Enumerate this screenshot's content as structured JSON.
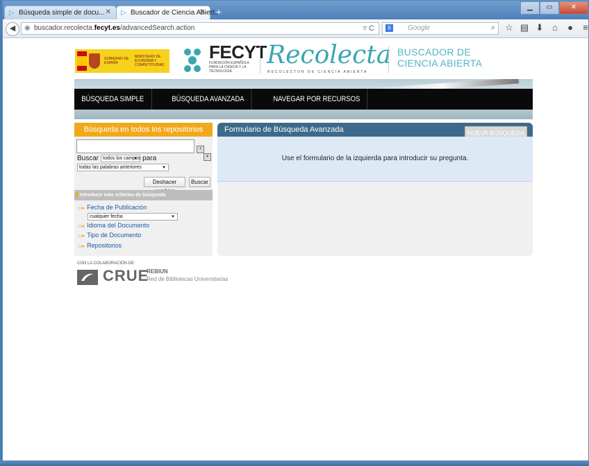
{
  "browser": {
    "tabs": [
      {
        "label": "Búsqueda simple de docu...",
        "active": false
      },
      {
        "label": "Buscador de Ciencia Abiert...",
        "active": true
      }
    ],
    "new_tab": "+",
    "url_prefix": "buscador.recolecta.",
    "url_host": "fecyt.es",
    "url_path": "/advancedSearch.action",
    "search_placeholder": "Google",
    "search_engine_icon": "8",
    "window_controls": [
      "minimize",
      "maximize",
      "close"
    ]
  },
  "header": {
    "gob_1": "GOBIERNO DE ESPAÑA",
    "gob_2": "MINISTERIO DE ECONOMÍA Y COMPETITIVIDAD",
    "fecyt": "FECYT",
    "fecyt_sub": "FUNDACIÓN ESPAÑOLA PARA LA CIENCIA Y LA TECNOLOGÍA",
    "recolecta": "Recolecta",
    "recolecta_sub": "RECOLECTOR DE CIENCIA ABIERTA",
    "buscador_1": "BUSCADOR DE",
    "buscador_2": "CIENCIA ABIERTA"
  },
  "menu": [
    "BÚSQUEDA SIMPLE",
    "BÚSQUEDA AVANZADA",
    "NAVEGAR POR RECURSOS"
  ],
  "left": {
    "title": "Búsqueda en todos los repositorios",
    "buscar": "Buscar",
    "campos": "todos los campos",
    "para": "para",
    "palabras": "todas las palabras anteriores",
    "deshacer": "Deshacer cambios",
    "buscar_btn": "Buscar",
    "criteria_title": "Introducir más criterios de búsqueda",
    "fecha": "Fecha de Publicación",
    "fecha_val": "cualquier fecha",
    "idioma": "Idioma del Documento",
    "tipo": "Tipo de Documento",
    "repos": "Repositorios"
  },
  "right": {
    "title": "Formulario de Búsqueda Avanzada",
    "new_search": "NUEVA BÚSQUEDA",
    "message": "Use el formulario de la izquierda para introducir su pregunta."
  },
  "footer": {
    "collab": "CON LA COLABORACIÓN DE:",
    "crue": "CRUE",
    "rebiun": "REBIUN",
    "rebiun_sub": "Red de Bibliotecas Universitarias"
  },
  "colors": {
    "accent": "#f2a81b",
    "panel_head": "#3d6a8a",
    "teal": "#3aa6b0"
  }
}
